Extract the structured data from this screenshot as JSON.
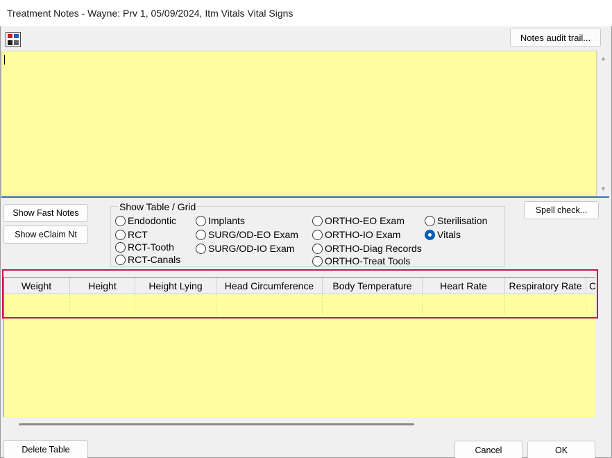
{
  "window": {
    "title": "Treatment Notes - Wayne: Prv 1, 05/09/2024, Itm Vitals Vital Signs"
  },
  "toolbar": {
    "spell_icon_name": "abc-spell-icon",
    "notes_audit_label": "Notes audit trail..."
  },
  "notes": {
    "value": ""
  },
  "buttons": {
    "show_fast_notes": "Show Fast Notes",
    "show_eclaim": "Show eClaim Nt",
    "spell_check": "Spell check...",
    "delete_table": "Delete Table",
    "cancel": "Cancel",
    "ok": "OK"
  },
  "show_table_group": {
    "label": "Show Table / Grid",
    "options": [
      {
        "label": "Endodontic",
        "selected": false
      },
      {
        "label": "RCT",
        "selected": false
      },
      {
        "label": "RCT-Tooth",
        "selected": false
      },
      {
        "label": "RCT-Canals",
        "selected": false
      },
      {
        "label": "Implants",
        "selected": false
      },
      {
        "label": "SURG/OD-EO Exam",
        "selected": false
      },
      {
        "label": "SURG/OD-IO Exam",
        "selected": false
      },
      {
        "label": "ORTHO-EO Exam",
        "selected": false
      },
      {
        "label": "ORTHO-IO Exam",
        "selected": false
      },
      {
        "label": "ORTHO-Diag Records",
        "selected": false
      },
      {
        "label": "ORTHO-Treat Tools",
        "selected": false
      },
      {
        "label": "Sterilisation",
        "selected": false
      },
      {
        "label": "Vitals",
        "selected": true
      }
    ]
  },
  "grid": {
    "columns": [
      "Weight",
      "Height",
      "Height Lying",
      "Head Circumference",
      "Body Temperature",
      "Heart Rate",
      "Respiratory Rate",
      "C"
    ],
    "rows": [
      [
        "",
        "",
        "",
        "",
        "",
        "",
        "",
        ""
      ]
    ]
  },
  "colors": {
    "notes_background": "#ffffa0",
    "highlight_frame": "#c8174e",
    "radio_selected": "#005fb8"
  }
}
